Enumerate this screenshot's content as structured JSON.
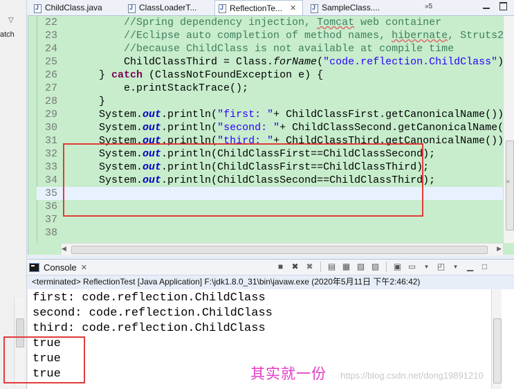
{
  "window": {
    "left_label": "atch"
  },
  "tabs": [
    {
      "label": "ChildClass.java",
      "active": false
    },
    {
      "label": "ClassLoaderT...",
      "active": false
    },
    {
      "label": "ReflectionTe...",
      "active": true
    },
    {
      "label": "SampleClass....",
      "active": false
    }
  ],
  "tabs_overflow": "»5",
  "editor": {
    "lines": [
      {
        "num": "22",
        "html": "        <span class='cm'>//Spring dependency injection, <span class='squig'>Tomcat</span> web container</span>"
      },
      {
        "num": "23",
        "html": "        <span class='cm'>//Eclipse auto completion of method names, <span class='squig'>hibernate</span>, Struts2</span>"
      },
      {
        "num": "24",
        "html": "        <span class='cm'>//because ChildClass is not available at compile time</span>"
      },
      {
        "num": "25",
        "html": "        ChildClassThird = Class.<span class='me'>forName</span>(<span class='st'>\"code.reflection.ChildClass\"</span>);"
      },
      {
        "num": "26",
        "html": "    } <span class='kw'>catch</span> (ClassNotFoundException e) {"
      },
      {
        "num": "27",
        "html": "        e.printStackTrace();"
      },
      {
        "num": "28",
        "html": "    }"
      },
      {
        "num": "29",
        "html": "    System.<span class='fi'>out</span>.println(<span class='st'>\"first: \"</span>+ ChildClassFirst.getCanonicalName());"
      },
      {
        "num": "30",
        "html": "    System.<span class='fi'>out</span>.println(<span class='st'>\"second: \"</span>+ ChildClassSecond.getCanonicalName());"
      },
      {
        "num": "31",
        "html": "    System.<span class='fi'>out</span>.println(<span class='st'>\"third: \"</span>+ ChildClassThird.getCanonicalName());"
      },
      {
        "num": "32",
        "html": "    System.<span class='fi'>out</span>.println(ChildClassFirst==ChildClassSecond);"
      },
      {
        "num": "33",
        "html": "    System.<span class='fi'>out</span>.println(ChildClassFirst==ChildClassThird);"
      },
      {
        "num": "34",
        "html": "    System.<span class='fi'>out</span>.println(ChildClassSecond==ChildClassThird);"
      },
      {
        "num": "35",
        "html": ""
      },
      {
        "num": "36",
        "html": ""
      },
      {
        "num": "37",
        "html": ""
      },
      {
        "num": "38",
        "html": ""
      }
    ],
    "current_line": "35"
  },
  "console": {
    "title": "Console",
    "close_glyph": "✕",
    "meta": "<terminated> ReflectionTest [Java Application] F:\\jdk1.8.0_31\\bin\\javaw.exe (2020年5月11日 下午2:46:42)",
    "output": [
      "first: code.reflection.ChildClass",
      "second: code.reflection.ChildClass",
      "third: code.reflection.ChildClass",
      "true",
      "true",
      "true"
    ]
  },
  "annotation": {
    "text": "其实就一份",
    "color": "#e33cc6",
    "box_color": "#e23a3a"
  },
  "watermark": "https://blog.csdn.net/dong19891210"
}
